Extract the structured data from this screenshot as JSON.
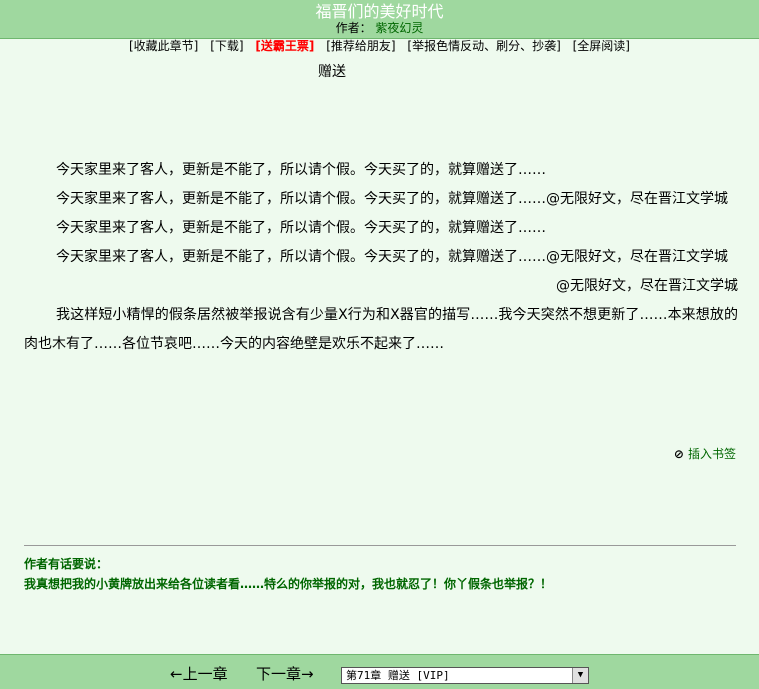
{
  "header": {
    "title": "福晋们的美好时代",
    "author_label": "作者：",
    "author_name": "紫夜幻灵"
  },
  "actions": [
    {
      "label": "[收藏此章节]"
    },
    {
      "label": "[下载]"
    },
    {
      "label": "[送霸王票]"
    },
    {
      "label": "[推荐给朋友]"
    },
    {
      "label": "[举报色情反动、刷分、抄袭]"
    },
    {
      "label": "[全屏阅读]"
    }
  ],
  "chapter": {
    "title": "赠送",
    "paragraphs": [
      "今天家里来了客人，更新是不能了，所以请个假。今天买了的，就算赠送了……",
      "今天家里来了客人，更新是不能了，所以请个假。今天买了的，就算赠送了……@无限好文，尽在晋江文学城",
      "今天家里来了客人，更新是不能了，所以请个假。今天买了的，就算赠送了……",
      "今天家里来了客人，更新是不能了，所以请个假。今天买了的，就算赠送了……@无限好文，尽在晋江文学城",
      "@无限好文，尽在晋江文学城",
      "我这样短小精悍的假条居然被举报说含有少量X行为和X器官的描写……我今天突然不想更新了……本来想放的肉也木有了……各位节哀吧……今天的内容绝壁是欢乐不起来了……"
    ]
  },
  "bookmark": {
    "icon": "paperclip-icon",
    "label": "插入书签"
  },
  "author_note": {
    "heading": "作者有话要说：",
    "text": "我真想把我的小黄牌放出来给各位读者看……特么的你举报的对，我也就忍了！你丫假条也举报？！"
  },
  "nav": {
    "prev": "←上一章",
    "next": "下一章→",
    "chapter_select_value": "第71章 赠送 [VIP]"
  },
  "colors": {
    "bar_green": "#9fd89f",
    "page_bg": "#eefaee",
    "accent_red": "#ff0000",
    "note_green": "#006600"
  }
}
